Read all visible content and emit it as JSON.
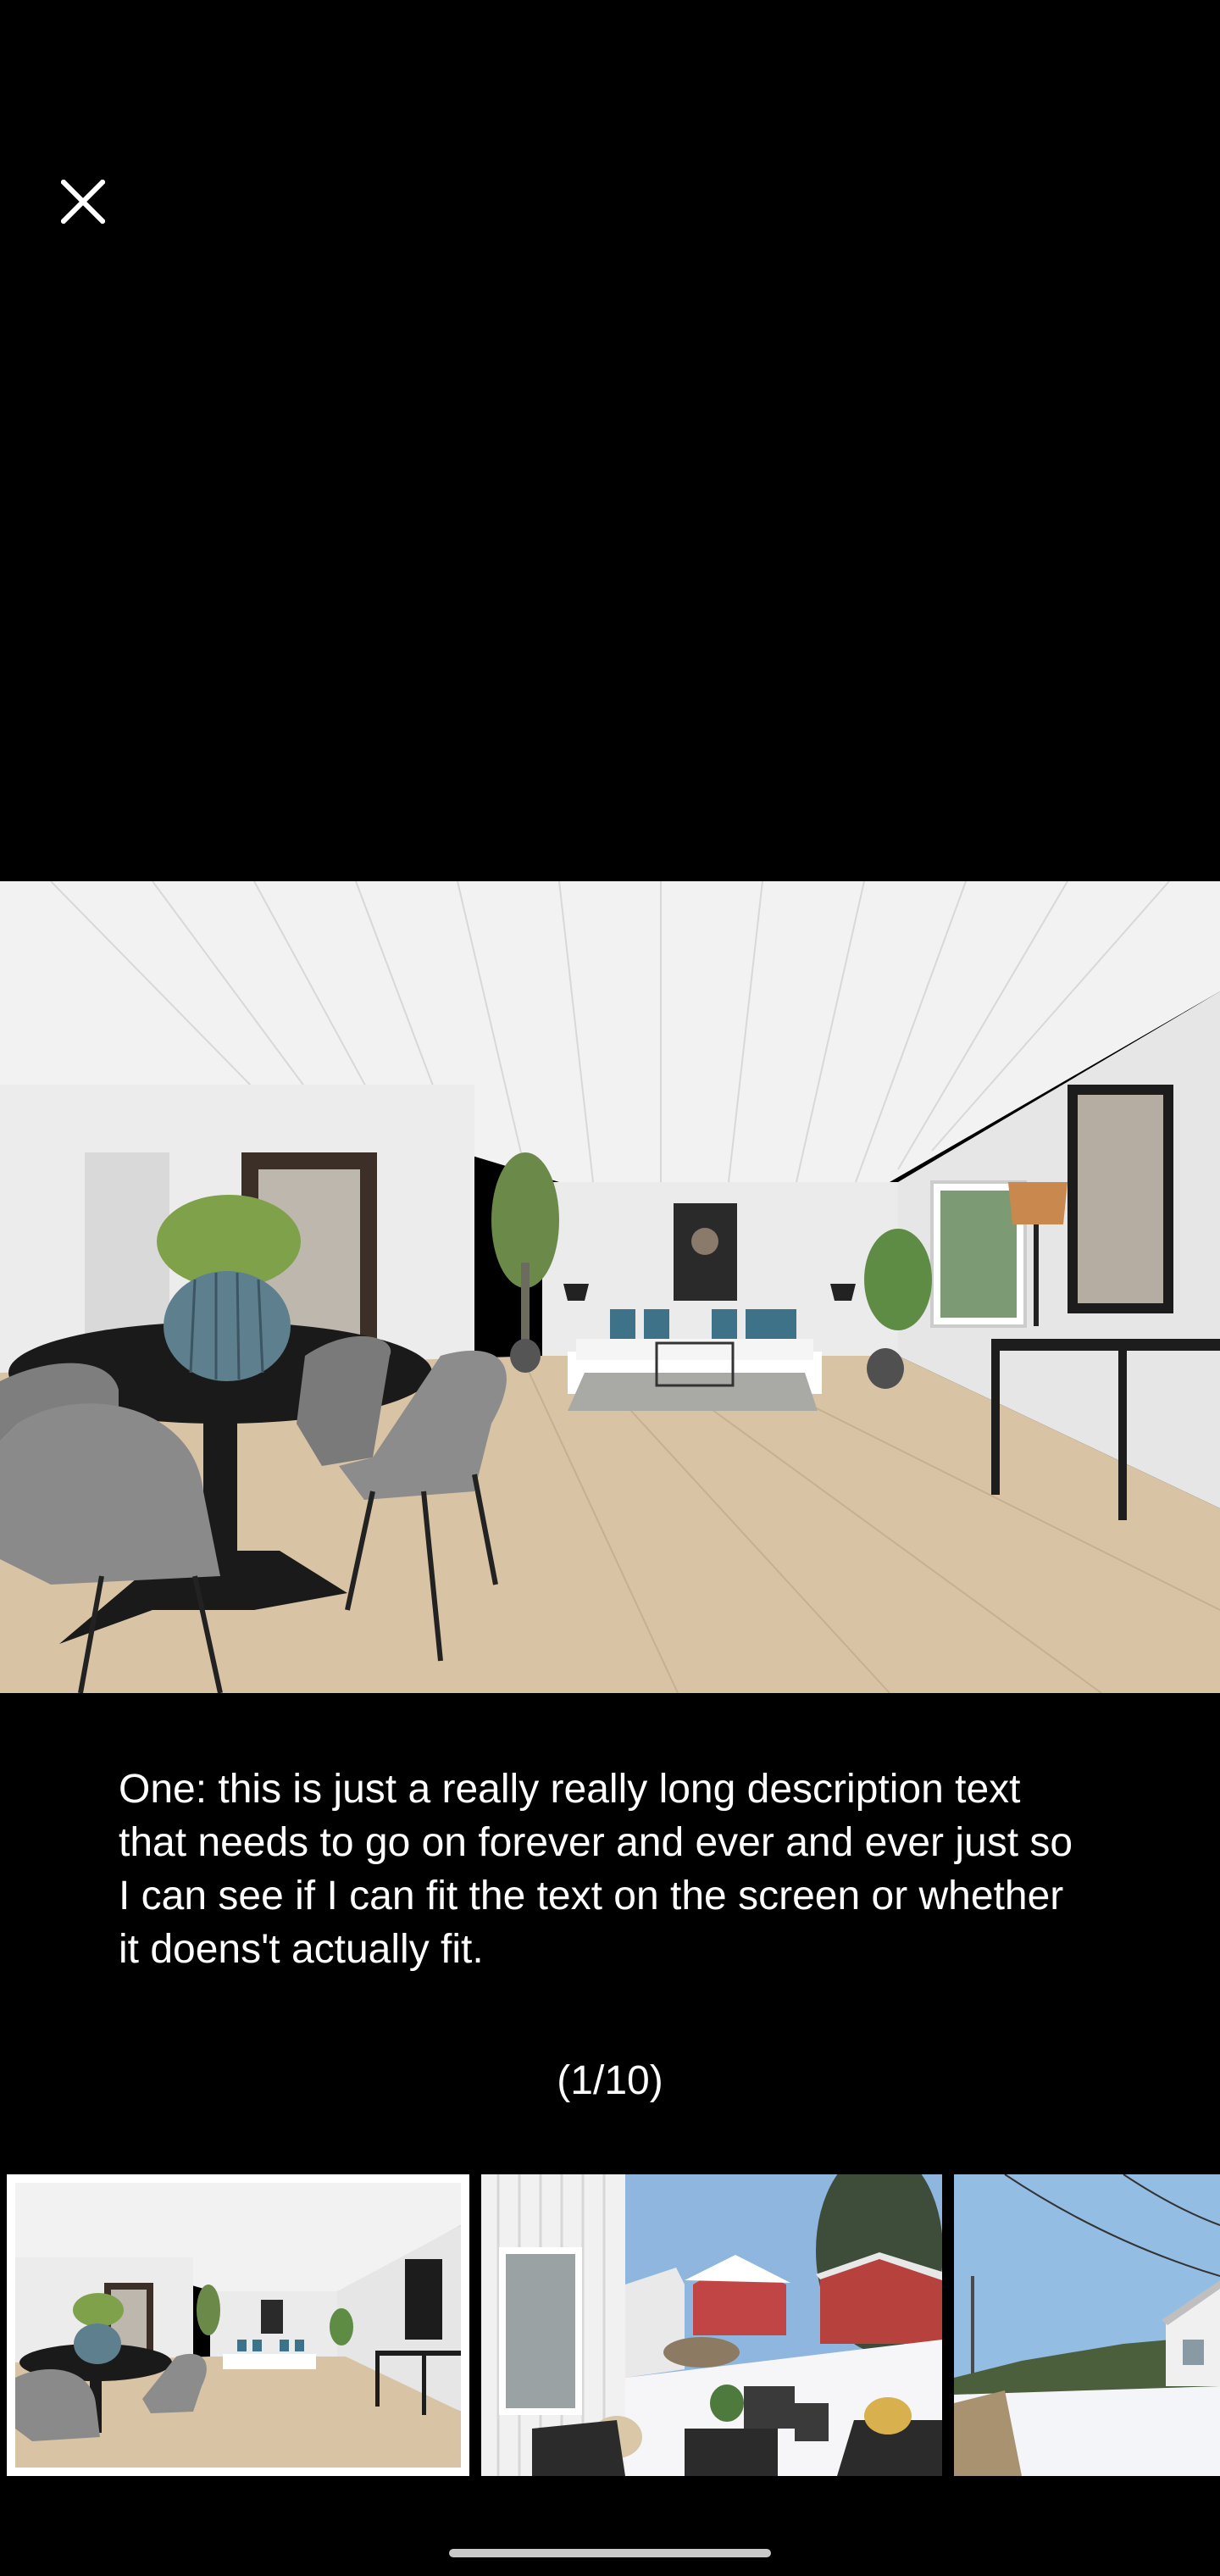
{
  "viewer": {
    "close_icon": "close-icon",
    "caption": "One: this is just a really really long description text that needs to go on forever and ever and ever just so I can see if I can fit the text on the screen or whether it doens't actually fit.",
    "counter": "(1/10)",
    "current_index": 1,
    "total": 10
  },
  "thumbnails": [
    {
      "subject": "living-dining-room",
      "selected": true
    },
    {
      "subject": "snowy-patio",
      "selected": false
    },
    {
      "subject": "snowy-street",
      "selected": false
    }
  ],
  "colors": {
    "background": "#000000",
    "text": "#ffffff",
    "selected_border": "#ffffff",
    "home_indicator": "#c9c9c9"
  }
}
